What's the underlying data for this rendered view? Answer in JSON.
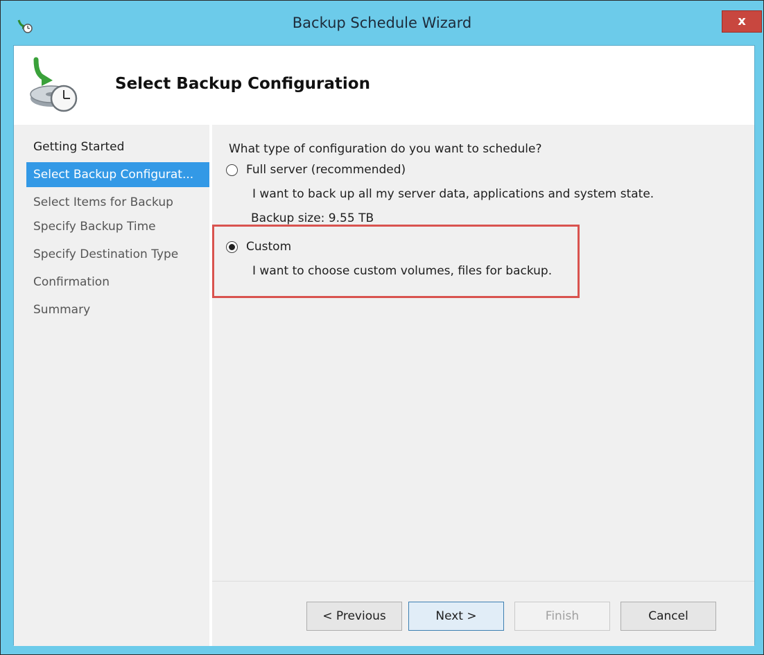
{
  "window": {
    "title": "Backup Schedule Wizard",
    "close_label": "x"
  },
  "header": {
    "title": "Select Backup Configuration"
  },
  "nav": {
    "items": [
      {
        "label": "Getting Started"
      },
      {
        "label": "Select Backup Configurat..."
      },
      {
        "label": "Select Items for Backup"
      },
      {
        "label": "Specify Backup Time"
      },
      {
        "label": "Specify Destination Type"
      },
      {
        "label": "Confirmation"
      },
      {
        "label": "Summary"
      }
    ],
    "active_index": 1
  },
  "main": {
    "question": "What type of configuration do you want to schedule?",
    "options": [
      {
        "label": "Full server (recommended)",
        "description": "I want to back up all my server data, applications and system state.",
        "detail": "Backup size: 9.55 TB",
        "selected": false
      },
      {
        "label": "Custom",
        "description": "I want to choose custom volumes, files for backup.",
        "selected": true
      }
    ]
  },
  "buttons": {
    "previous": "< Previous",
    "next": "Next >",
    "finish": "Finish",
    "cancel": "Cancel"
  },
  "colors": {
    "title_bar": "#6ccbea",
    "nav_selected": "#3399e6",
    "highlight_box": "#d9534f",
    "close_button": "#c8473f"
  },
  "icons": {
    "app": "backup-clock-icon",
    "header": "backup-schedule-icon",
    "close": "close-icon"
  }
}
